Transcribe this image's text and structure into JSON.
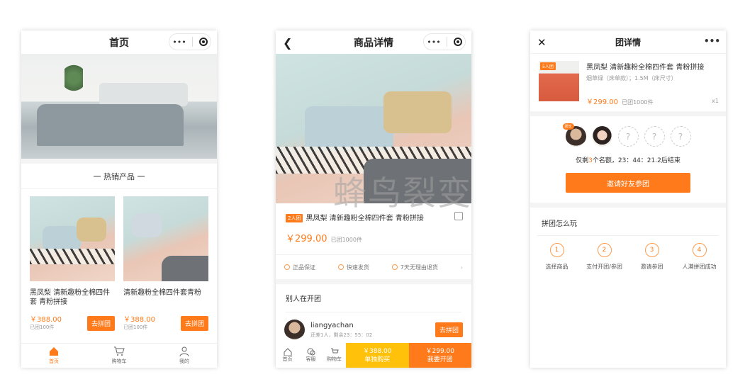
{
  "phone1": {
    "nav_title": "首页",
    "capsule_more": "•••",
    "section_title": "一  热销产品  一",
    "products": [
      {
        "name": "黑凤梨 清新趣粉全棉四件套 青粉拼接",
        "price": "￥388.00",
        "sold": "已团100件",
        "button": "去拼团"
      },
      {
        "name": "清新趣粉全棉四件套青粉",
        "price": "￥388.00",
        "sold": "已团100件",
        "button": "去拼团"
      }
    ],
    "tabs": [
      {
        "label": "首页",
        "icon": "home-icon"
      },
      {
        "label": "购物车",
        "icon": "cart-icon"
      },
      {
        "label": "我的",
        "icon": "user-icon"
      }
    ],
    "accent_color": "#ff7a1a"
  },
  "phone2": {
    "nav_title": "商品详情",
    "capsule_more": "•••",
    "group_badge": "2人团",
    "product_name": "黑凤梨 清新趣粉全棉四件套 青粉拼接",
    "price": "￥299.00",
    "sold": "已团1000件",
    "services": [
      "正品保证",
      "快速发货",
      "7天无理由退货"
    ],
    "others_title": "别人在开团",
    "group_user": "liangyachan",
    "group_status": "还差1人，剩余23：55：02",
    "join_button": "去拼团",
    "bottom": {
      "icons": [
        "首页",
        "客服",
        "购物车"
      ],
      "buy_alone_price": "￥388.00",
      "buy_alone_label": "单独购买",
      "group_price": "￥299.00",
      "group_label": "我要开团"
    }
  },
  "phone3": {
    "nav_title": "团详情",
    "capsule_more": "•••",
    "group_badge": "5人团",
    "product_name": "黑凤梨 清新趣粉全棉四件套 青粉拼接",
    "variant": "烟草绿（床单款）；1.5M（床尺寸）",
    "price": "￥299.00",
    "sold": "已团1000件",
    "qty": "x1",
    "leader_badge": "团长",
    "remain_prefix": "仅剩",
    "remain_count": "3",
    "remain_suffix": "个名额，23：44：21.2后结束",
    "invite_button": "邀请好友参团",
    "howto_title": "拼团怎么玩",
    "steps": [
      {
        "n": "1",
        "label": "选择商品"
      },
      {
        "n": "2",
        "label": "支付开团/参团"
      },
      {
        "n": "3",
        "label": "邀请参团"
      },
      {
        "n": "4",
        "label": "人满拼团成功"
      }
    ]
  },
  "watermark": "蜂鸟裂变"
}
